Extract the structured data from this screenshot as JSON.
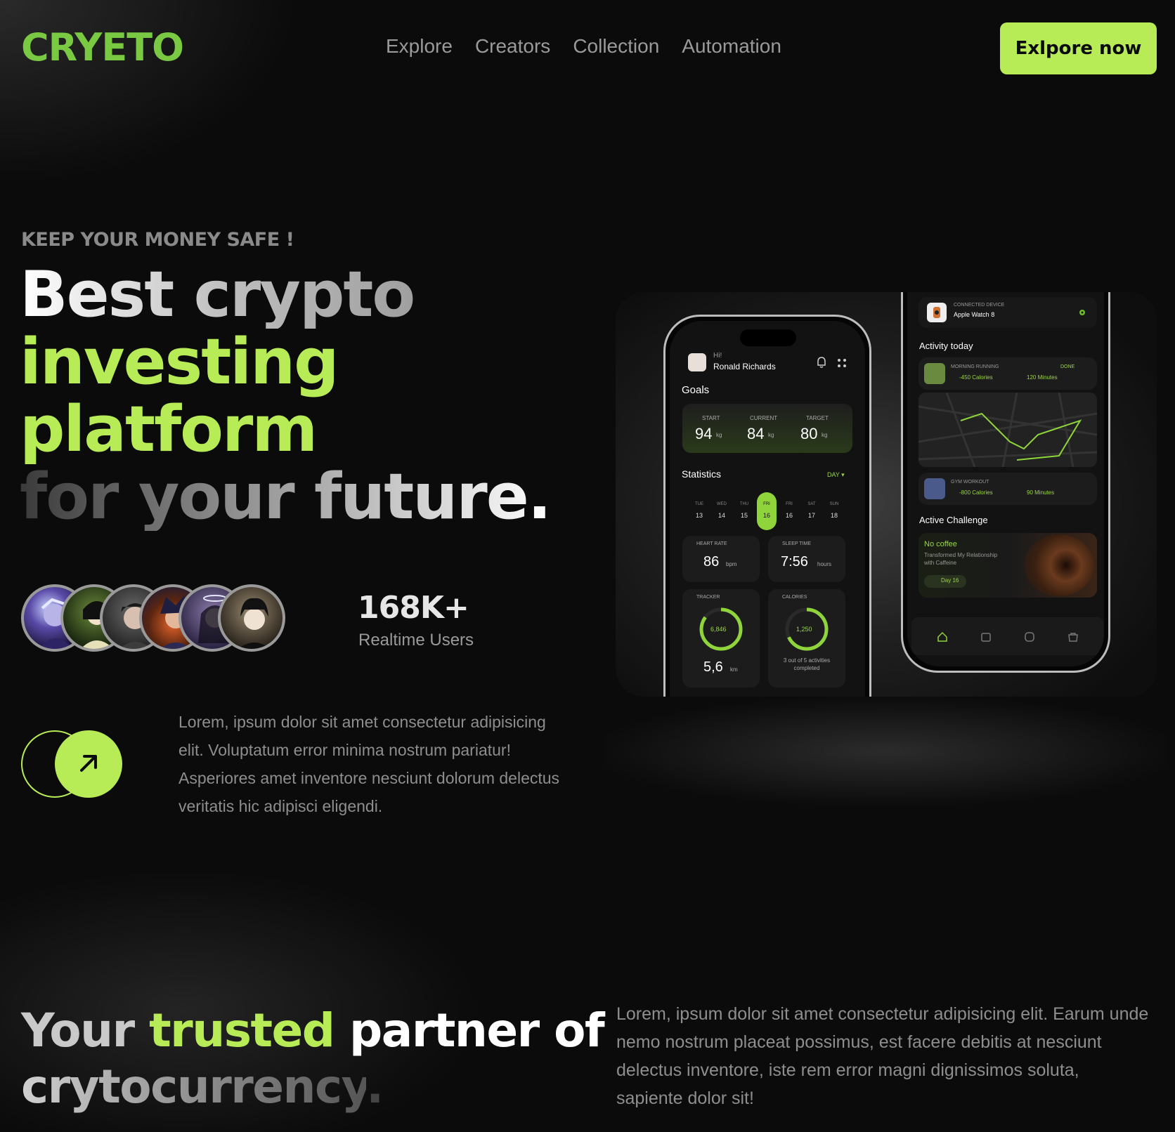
{
  "brand": {
    "logo": "CRYETO",
    "accent": "#b8ec57",
    "logo_color": "#7ac943",
    "background": "#0b0b0b"
  },
  "nav": {
    "items": [
      "Explore",
      "Creators",
      "Collection",
      "Automation"
    ]
  },
  "header": {
    "cta_label": "Exlpore now"
  },
  "hero": {
    "eyebrow": "KEEP YOUR MONEY SAFE !",
    "line1": "Best crypto",
    "line2": "investing",
    "line3": "platform",
    "line4": "for your future.",
    "users_count": "168K+",
    "users_label": "Realtime Users",
    "description": "Lorem, ipsum dolor sit amet consectetur adipisicing elit. Voluptatum error minima nostrum pariatur! Asperiores amet inventore nesciunt dolorum delectus veritatis hic adipisci eligendi."
  },
  "phone_left": {
    "greeting": "Hi!",
    "user": "Ronald Richards",
    "goals_title": "Goals",
    "goals": [
      {
        "label": "START",
        "value": "94",
        "unit": "kg"
      },
      {
        "label": "CURRENT",
        "value": "84",
        "unit": "kg"
      },
      {
        "label": "TARGET",
        "value": "80",
        "unit": "kg"
      }
    ],
    "stats_title": "Statistics",
    "stats_period": "DAY ▾",
    "days": [
      {
        "d": "TUE",
        "n": "13"
      },
      {
        "d": "WED",
        "n": "14"
      },
      {
        "d": "THU",
        "n": "15"
      },
      {
        "d": "FRI",
        "n": "16"
      },
      {
        "d": "FRI",
        "n": "16"
      },
      {
        "d": "SAT",
        "n": "17"
      },
      {
        "d": "SUN",
        "n": "18"
      }
    ],
    "heart_label": "HEART RATE",
    "heart_value": "86",
    "heart_unit": "bpm",
    "sleep_label": "SLEEP TIME",
    "sleep_value": "7:56",
    "sleep_unit": "hours",
    "tracker_label": "TRACKER",
    "tracker_ring": "6,846",
    "tracker_value": "5,6",
    "tracker_unit": "km",
    "calories_label": "CALORIES",
    "calories_ring": "1,250",
    "calories_note": "3 out of 5 activities completed"
  },
  "phone_right": {
    "device_label": "CONNECTED DEVICE",
    "device_name": "Apple Watch 8",
    "activity_title": "Activity  today",
    "run_label": "MORNING RUNNING",
    "run_status": "DONE",
    "run_cal": "-450 Calories",
    "run_min": "120 Minutes",
    "gym_label": "GYM WORKOUT",
    "gym_cal": "-800 Calories",
    "gym_min": "90 Minutes",
    "challenge_title": "Active Challenge",
    "challenge_name": "No coffee",
    "challenge_desc": "Transformed My Relationship with Caffeine",
    "challenge_day": "Day 16"
  },
  "section2": {
    "title_a": "Your",
    "title_b": "trusted",
    "title_c": "partner of",
    "title_d": "crytocurrency",
    "title_e": ".",
    "description": "Lorem, ipsum dolor sit amet consectetur adipisicing elit. Earum unde nemo nostrum placeat possimus, est facere debitis at nesciunt delectus inventore, iste rem error magni dignissimos soluta, sapiente dolor sit!"
  }
}
